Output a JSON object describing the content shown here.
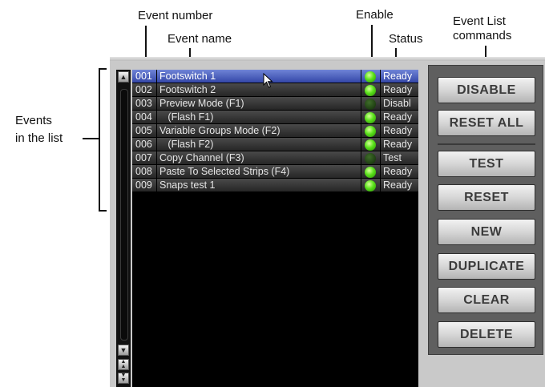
{
  "callouts": {
    "event_number": "Event number",
    "event_name": "Event name",
    "enable": "Enable",
    "status": "Status",
    "event_list_commands_line1": "Event List",
    "event_list_commands_line2": "commands",
    "events_line1": "Events",
    "events_line2": "in the list"
  },
  "events": [
    {
      "number": "001",
      "name": "Footswitch 1",
      "enabled": true,
      "status": "Ready",
      "selected": true
    },
    {
      "number": "002",
      "name": "Footswitch 2",
      "enabled": true,
      "status": "Ready",
      "selected": false
    },
    {
      "number": "003",
      "name": "Preview Mode (F1)",
      "enabled": false,
      "status": "Disabl",
      "selected": false
    },
    {
      "number": "004",
      "name": "   (Flash F1)",
      "enabled": true,
      "status": "Ready",
      "selected": false
    },
    {
      "number": "005",
      "name": "Variable Groups Mode (F2)",
      "enabled": true,
      "status": "Ready",
      "selected": false
    },
    {
      "number": "006",
      "name": "   (Flash F2)",
      "enabled": true,
      "status": "Ready",
      "selected": false
    },
    {
      "number": "007",
      "name": "Copy Channel (F3)",
      "enabled": false,
      "status": "Test",
      "selected": false
    },
    {
      "number": "008",
      "name": "Paste To Selected Strips (F4)",
      "enabled": true,
      "status": "Ready",
      "selected": false
    },
    {
      "number": "009",
      "name": "Snaps test 1",
      "enabled": true,
      "status": "Ready",
      "selected": false
    }
  ],
  "commands": {
    "disable": "DISABLE",
    "reset_all": "RESET ALL",
    "test": "TEST",
    "reset": "RESET",
    "new": "NEW",
    "duplicate": "DUPLICATE",
    "clear": "CLEAR",
    "delete": "DELETE"
  },
  "icons": {
    "scroll_up": "triangle-up-icon",
    "scroll_down": "triangle-down-icon",
    "scroll_page": "double-arrow-icon",
    "cursor": "mouse-pointer-icon"
  },
  "colors": {
    "selected_row": "#3447a8",
    "led_on": "#59e01a",
    "led_off": "#1e3e12",
    "button_text": "#3c3c3c"
  }
}
